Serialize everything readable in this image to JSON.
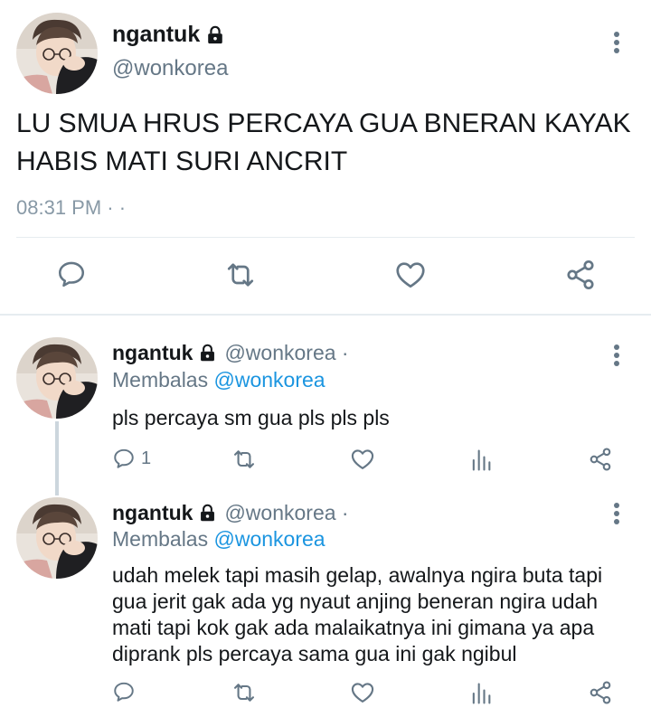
{
  "main_tweet": {
    "display_name": "ngantuk",
    "handle": "@wonkorea",
    "text": "LU SMUA HRUS PERCAYA GUA BNERAN KAYAK HABIS MATI SURI ANCRIT",
    "time": "08:31 PM · ·",
    "icons": [
      "lock-icon",
      "more-vertical-icon",
      "reply-icon",
      "retweet-icon",
      "like-icon",
      "share-icon"
    ]
  },
  "replies": [
    {
      "display_name": "ngantuk",
      "handle": "@wonkorea ·",
      "reply_prefix": "Membalas",
      "reply_mention": "@wonkorea",
      "text": "pls percaya sm gua pls pls pls",
      "reply_count": "1"
    },
    {
      "display_name": "ngantuk",
      "handle": "@wonkorea ·",
      "reply_prefix": "Membalas",
      "reply_mention": "@wonkorea",
      "text": "udah melek tapi masih gelap, awalnya ngira buta tapi gua jerit gak ada yg nyaut anjing beneran ngira udah mati tapi kok gak ada malaikatnya ini gimana ya apa diprank pls percaya sama gua ini gak ngibul",
      "reply_count": ""
    }
  ],
  "colors": {
    "text": "#14171a",
    "secondary": "#657786",
    "mention": "#1b95e0",
    "divider": "#e6ecf0"
  }
}
